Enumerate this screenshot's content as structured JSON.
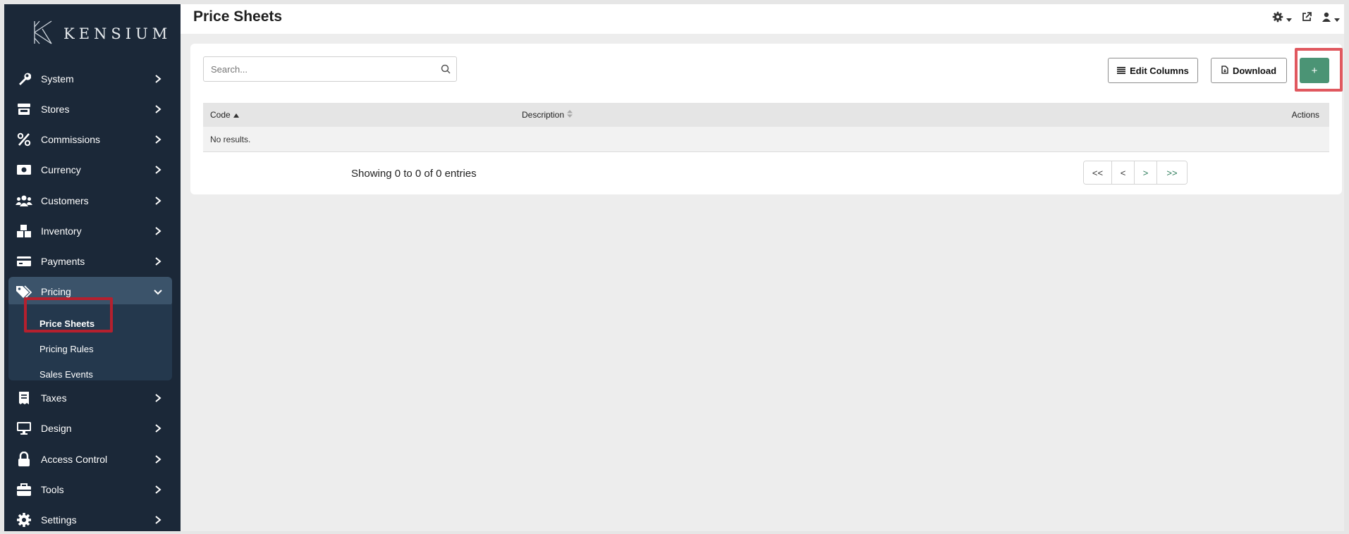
{
  "app": {
    "logo_text": "KENSIUM",
    "accent_color": "#4b9475",
    "sidebar_color": "#1b2838"
  },
  "sidebar": {
    "items": [
      {
        "label": "System",
        "icon": "wrench-icon"
      },
      {
        "label": "Stores",
        "icon": "store-icon"
      },
      {
        "label": "Commissions",
        "icon": "percent-icon"
      },
      {
        "label": "Currency",
        "icon": "money-bill-icon"
      },
      {
        "label": "Customers",
        "icon": "users-icon"
      },
      {
        "label": "Inventory",
        "icon": "boxes-icon"
      },
      {
        "label": "Payments",
        "icon": "credit-card-icon"
      },
      {
        "label": "Pricing",
        "icon": "tags-icon"
      },
      {
        "label": "Taxes",
        "icon": "receipt-icon"
      },
      {
        "label": "Design",
        "icon": "desktop-icon"
      },
      {
        "label": "Access Control",
        "icon": "lock-icon"
      },
      {
        "label": "Tools",
        "icon": "toolbox-icon"
      },
      {
        "label": "Settings",
        "icon": "gear-icon"
      }
    ],
    "pricing_submenu": [
      {
        "label": "Price Sheets"
      },
      {
        "label": "Pricing Rules"
      },
      {
        "label": "Sales Events"
      }
    ]
  },
  "header": {
    "title": "Price Sheets"
  },
  "toolbar": {
    "search_placeholder": "Search...",
    "edit_columns_label": "Edit Columns",
    "download_label": "Download",
    "add_label": "+"
  },
  "table": {
    "columns": [
      "Code",
      "Description",
      "Actions"
    ],
    "empty_message": "No results."
  },
  "pagination": {
    "summary": "Showing 0 to 0 of 0 entries",
    "first": "<<",
    "prev": "<",
    "next": ">",
    "last": ">>"
  }
}
